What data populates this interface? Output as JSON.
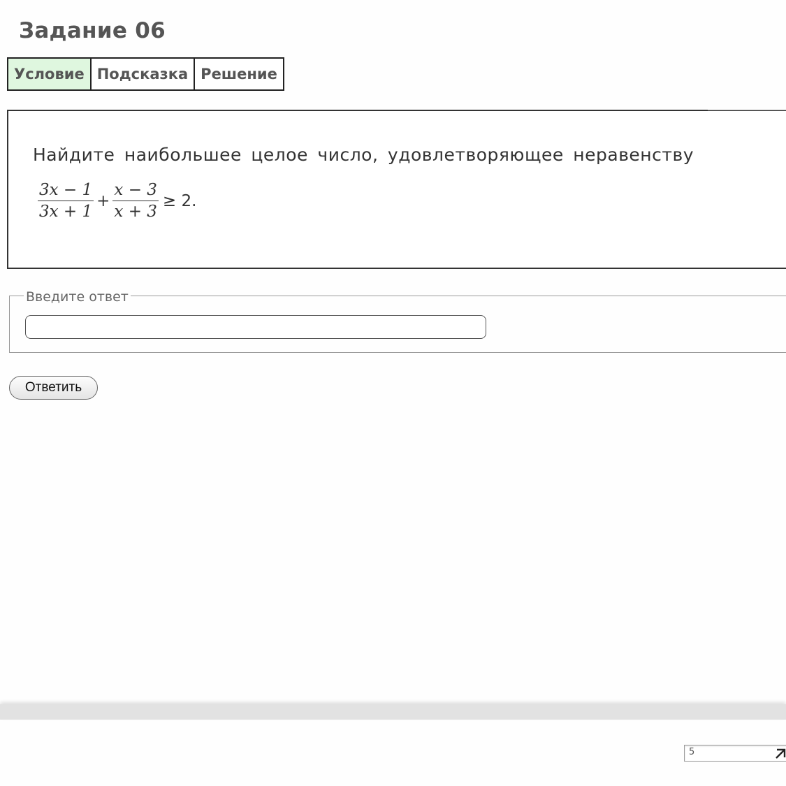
{
  "header": {
    "task_title": "Задание 06"
  },
  "tabs": [
    {
      "label": "Условие",
      "active": true
    },
    {
      "label": "Подсказка",
      "active": false
    },
    {
      "label": "Решение",
      "active": false
    }
  ],
  "problem": {
    "text": "Найдите наибольшее целое число, удовлетворяющее неравенству",
    "fraction1": {
      "numerator": "3x − 1",
      "denominator": "3x + 1"
    },
    "operator": "+",
    "fraction2": {
      "numerator": "x − 3",
      "denominator": "x + 3"
    },
    "tail": "≥ 2."
  },
  "answer": {
    "legend": "Введите ответ",
    "value": "",
    "submit_label": "Ответить"
  },
  "footer": {
    "pager_value": "5"
  },
  "colors": {
    "active_tab_bg": "#dff7df",
    "title_text": "#555555"
  },
  "icons": {
    "expand": "expand-arrow-icon"
  }
}
